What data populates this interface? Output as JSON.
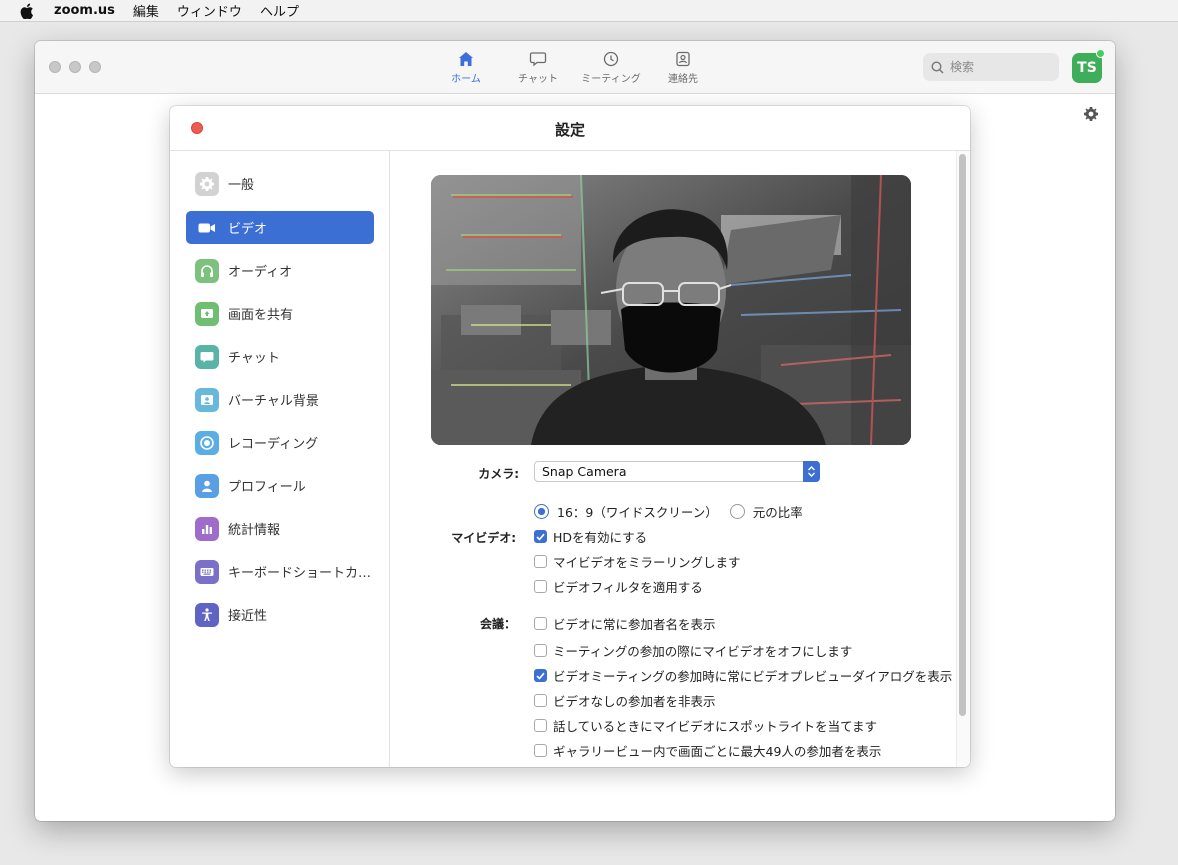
{
  "menubar": {
    "app_name": "zoom.us",
    "items": [
      "編集",
      "ウィンドウ",
      "ヘルプ"
    ]
  },
  "toolbar": {
    "tabs": [
      {
        "label": "ホーム",
        "icon": "home-icon",
        "active": true
      },
      {
        "label": "チャット",
        "icon": "chat-icon",
        "active": false
      },
      {
        "label": "ミーティング",
        "icon": "clock-icon",
        "active": false
      },
      {
        "label": "連絡先",
        "icon": "contacts-icon",
        "active": false
      }
    ],
    "search_placeholder": "検索",
    "avatar_initials": "TS",
    "presence_color": "#3ed15a"
  },
  "dialog": {
    "title": "設定",
    "sidebar": [
      {
        "label": "一般",
        "icon": "gear-icon",
        "color": "#c9c9c9",
        "active": false
      },
      {
        "label": "ビデオ",
        "icon": "video-camera-icon",
        "color": "#3b6fd4",
        "active": true
      },
      {
        "label": "オーディオ",
        "icon": "headphones-icon",
        "color": "#7cc27e",
        "active": false
      },
      {
        "label": "画面を共有",
        "icon": "share-screen-icon",
        "color": "#6fbe72",
        "active": false
      },
      {
        "label": "チャット",
        "icon": "chat-bubble-icon",
        "color": "#59b3a6",
        "active": false
      },
      {
        "label": "バーチャル背景",
        "icon": "virtual-background-icon",
        "color": "#67b8dc",
        "active": false
      },
      {
        "label": "レコーディング",
        "icon": "record-icon",
        "color": "#5aaee3",
        "active": false
      },
      {
        "label": "プロフィール",
        "icon": "profile-icon",
        "color": "#5a9ee3",
        "active": false
      },
      {
        "label": "統計情報",
        "icon": "statistics-icon",
        "color": "#9e6dc9",
        "active": false
      },
      {
        "label": "キーボードショートカ…",
        "icon": "keyboard-icon",
        "color": "#7a6fc9",
        "active": false
      },
      {
        "label": "接近性",
        "icon": "accessibility-icon",
        "color": "#5f63c4",
        "active": false
      }
    ],
    "video": {
      "camera_label": "カメラ:",
      "camera_value": "Snap Camera",
      "my_video_label": "マイビデオ:",
      "aspect_options": [
        {
          "label": "16：9（ワイドスクリーン）",
          "selected": true
        },
        {
          "label": "元の比率",
          "selected": false
        }
      ],
      "my_video_options": [
        {
          "label": "HDを有効にする",
          "checked": true
        },
        {
          "label": "マイビデオをミラーリングします",
          "checked": false
        },
        {
          "label": "ビデオフィルタを適用する",
          "checked": false
        }
      ],
      "meeting_label": "会議：",
      "meeting_options": [
        {
          "label": "ビデオに常に参加者名を表示",
          "checked": false
        },
        {
          "label": "ミーティングの参加の際にマイビデオをオフにします",
          "checked": false
        },
        {
          "label": "ビデオミーティングの参加時に常にビデオプレビューダイアログを表示",
          "checked": true
        },
        {
          "label": "ビデオなしの参加者を非表示",
          "checked": false
        },
        {
          "label": "話しているときにマイビデオにスポットライトを当てます",
          "checked": false
        },
        {
          "label": "ギャラリービュー内で画面ごとに最大49人の参加者を表示",
          "checked": false
        }
      ]
    }
  },
  "colors": {
    "accent": "#3b6fd4",
    "tab_active": "#3d6fd8",
    "avatar_bg": "#3fae5a",
    "close_red": "#ee5b53"
  }
}
